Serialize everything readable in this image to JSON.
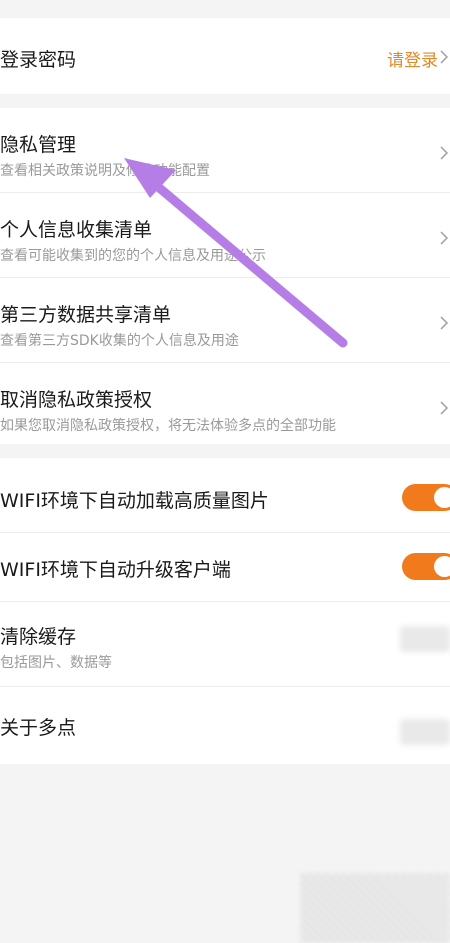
{
  "account": {
    "login_password": {
      "label": "登录密码",
      "action_label": "请登录"
    }
  },
  "privacy": {
    "items": [
      {
        "title": "隐私管理",
        "subtitle": "查看相关政策说明及修改功能配置"
      },
      {
        "title": "个人信息收集清单",
        "subtitle": "查看可能收集到的您的个人信息及用途公示"
      },
      {
        "title": "第三方数据共享清单",
        "subtitle": "查看第三方SDK收集的个人信息及用途"
      },
      {
        "title": "取消隐私政策授权",
        "subtitle": "如果您取消隐私政策授权，将无法体验多点的全部功能"
      }
    ]
  },
  "settings": {
    "wifi_hd_images": {
      "label": "WIFI环境下自动加载高质量图片",
      "enabled": true
    },
    "wifi_auto_upgrade": {
      "label": "WIFI环境下自动升级客户端",
      "enabled": true
    },
    "clear_cache": {
      "label": "清除缓存",
      "subtitle": "包括图片、数据等"
    },
    "about": {
      "label": "关于多点"
    }
  },
  "colors": {
    "accent": "#f07a1c",
    "link": "#e2892a",
    "annotation_arrow": "#b57ee6"
  },
  "icons": {
    "chevron": "chevron-right-icon",
    "annotation": "annotation-arrow-icon"
  }
}
